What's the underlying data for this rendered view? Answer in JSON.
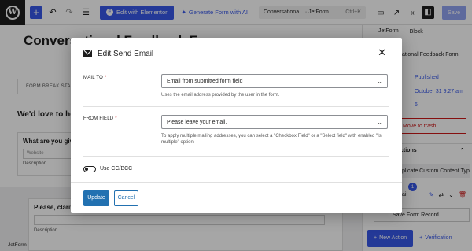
{
  "toolbar": {
    "elementor_label": "Edit with Elementor",
    "generate_label": "Generate Form with AI",
    "doc_title": "Conversationa... · JetForm",
    "shortcut": "Ctrl+K",
    "save_label": "Save"
  },
  "canvas": {
    "page_title": "Conversational Feedback F",
    "form_break": "FORM BREAK STAR",
    "love_text": "We'd love to hea",
    "question1": "What are you giv",
    "question1_placeholder": "Website",
    "question1_desc": "Description...",
    "question2": "Please, clarif",
    "question2_desc": "Description...",
    "breadcrumb": "JetForm"
  },
  "sidebar": {
    "tab_jetform": "JetForm",
    "tab_block": "Block",
    "form_name": "ational Feedback Form",
    "status": "Published",
    "date": "October 31 9:27 am",
    "count": "6",
    "trash_label": "Move to trash",
    "section_title": "ctions",
    "duplicate_label": "plicate Custom Content Type",
    "mail_label": "ail",
    "badge_count": "1",
    "save_record_label": "Save Form Record",
    "new_action_label": "New Action",
    "verification_label": "Verification"
  },
  "modal": {
    "title": "Edit Send Email",
    "mail_to_label": "MAIL TO",
    "mail_to_value": "Email from submitted form field",
    "mail_to_help": "Uses the email address provided by the user in the form.",
    "from_field_label": "FROM FIELD",
    "from_field_value": "Please leave your email.",
    "from_field_help": "To apply multiple mailing addresses, you can select a \"Checkbox Field\" or a \"Select field\" with enabled \"Is multiple\" option.",
    "cc_label": "Use CC/BCC",
    "update_label": "Update",
    "cancel_label": "Cancel"
  },
  "colors": {
    "accent": "#3858e9",
    "primary_button": "#2271b1",
    "danger": "#cc1818",
    "success": "#007017"
  }
}
